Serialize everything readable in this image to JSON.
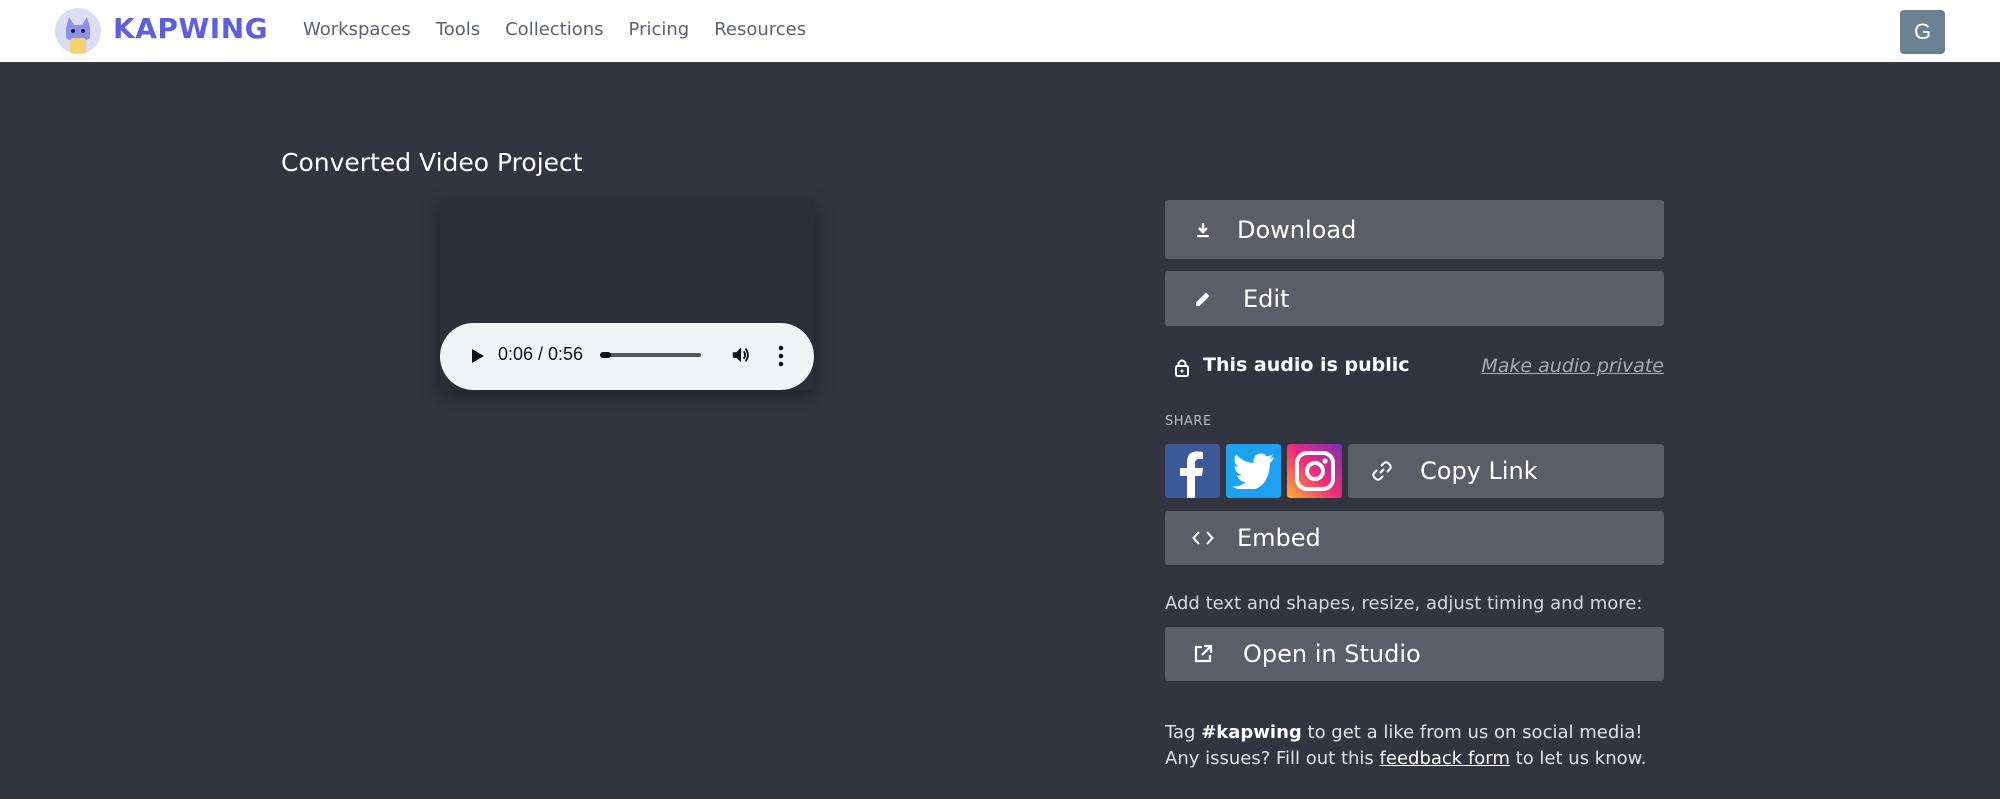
{
  "header": {
    "brand": "KAPWING",
    "nav": [
      "Workspaces",
      "Tools",
      "Collections",
      "Pricing",
      "Resources"
    ],
    "avatar_initial": "G"
  },
  "project": {
    "title": "Converted Video Project"
  },
  "player": {
    "time": "0:06 / 0:56",
    "progress_fraction": 0.107
  },
  "actions": {
    "download": "Download",
    "edit": "Edit",
    "copy_link": "Copy Link",
    "embed": "Embed",
    "open_studio": "Open in Studio"
  },
  "privacy": {
    "status": "This audio is public",
    "toggle": "Make audio private"
  },
  "share": {
    "label": "SHARE",
    "networks": [
      "facebook-icon",
      "twitter-icon",
      "instagram-icon"
    ]
  },
  "studio_note": "Add text and shapes, resize, adjust timing and more:",
  "tag_note": {
    "prefix": "Tag ",
    "hashtag": "#kapwing",
    "middle": " to get a like from us on social media! Any issues? Fill out this ",
    "link": "feedback form",
    "suffix": " to let us know."
  },
  "colors": {
    "background": "#32343f",
    "button": "#5b5d69",
    "brand": "#5b5fe0",
    "facebook": "#3b5998",
    "twitter": "#1da1f2"
  }
}
